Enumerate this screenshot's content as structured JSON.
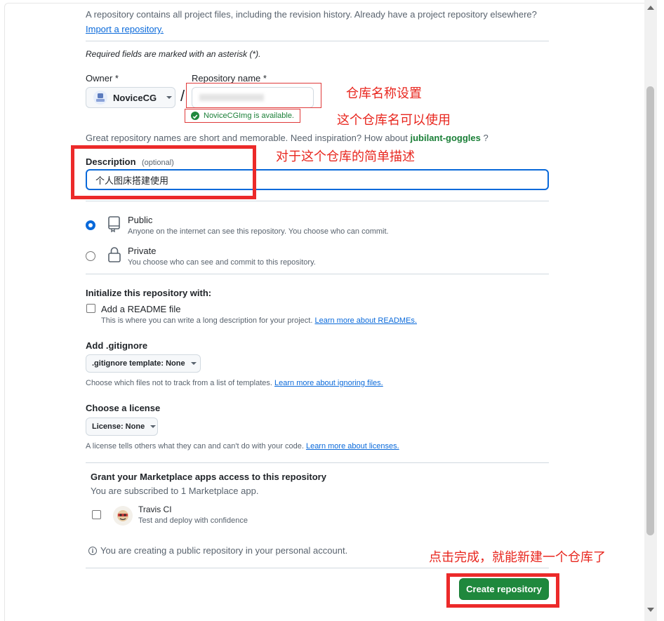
{
  "intro": {
    "text": "A repository contains all project files, including the revision history. Already have a project repository elsewhere?",
    "import_link": "Import a repository."
  },
  "required_note": "Required fields are marked with an asterisk (*).",
  "owner": {
    "label": "Owner *",
    "name": "NoviceCG"
  },
  "repo_name": {
    "label": "Repository name *",
    "value": "",
    "available_msg": "NoviceCGImg is available."
  },
  "separator": "/",
  "suggestion": {
    "text": "Great repository names are short and memorable. Need inspiration? How about",
    "name": "jubilant-goggles",
    "suffix": "?"
  },
  "description": {
    "label": "Description",
    "optional": "(optional)",
    "value": "个人图床搭建使用"
  },
  "visibility": {
    "public": {
      "title": "Public",
      "desc": "Anyone on the internet can see this repository. You choose who can commit.",
      "selected": true
    },
    "private": {
      "title": "Private",
      "desc": "You choose who can see and commit to this repository.",
      "selected": false
    }
  },
  "init": {
    "heading": "Initialize this repository with:",
    "readme_label": "Add a README file",
    "readme_desc": "This is where you can write a long description for your project.",
    "readme_link": "Learn more about READMEs."
  },
  "gitignore": {
    "heading": "Add .gitignore",
    "button": ".gitignore template: None",
    "desc": "Choose which files not to track from a list of templates.",
    "link": "Learn more about ignoring files."
  },
  "license": {
    "heading": "Choose a license",
    "button": "License: None",
    "desc": "A license tells others what they can and can't do with your code.",
    "link": "Learn more about licenses."
  },
  "marketplace": {
    "heading": "Grant your Marketplace apps access to this repository",
    "sub": "You are subscribed to 1 Marketplace app.",
    "app_name": "Travis CI",
    "app_desc": "Test and deploy with confidence"
  },
  "public_notice": "You are creating a public repository in your personal account.",
  "create_button": "Create repository",
  "annotations": {
    "repo_name_setting": "仓库名称设置",
    "name_usable": "这个仓库名可以使用",
    "description_hint": "对于这个仓库的简单描述",
    "click_finish": "点击完成，就能新建一个仓库了"
  },
  "colors": {
    "accent": "#0969da",
    "success": "#1f883d",
    "annotation_red": "#e8261e"
  }
}
